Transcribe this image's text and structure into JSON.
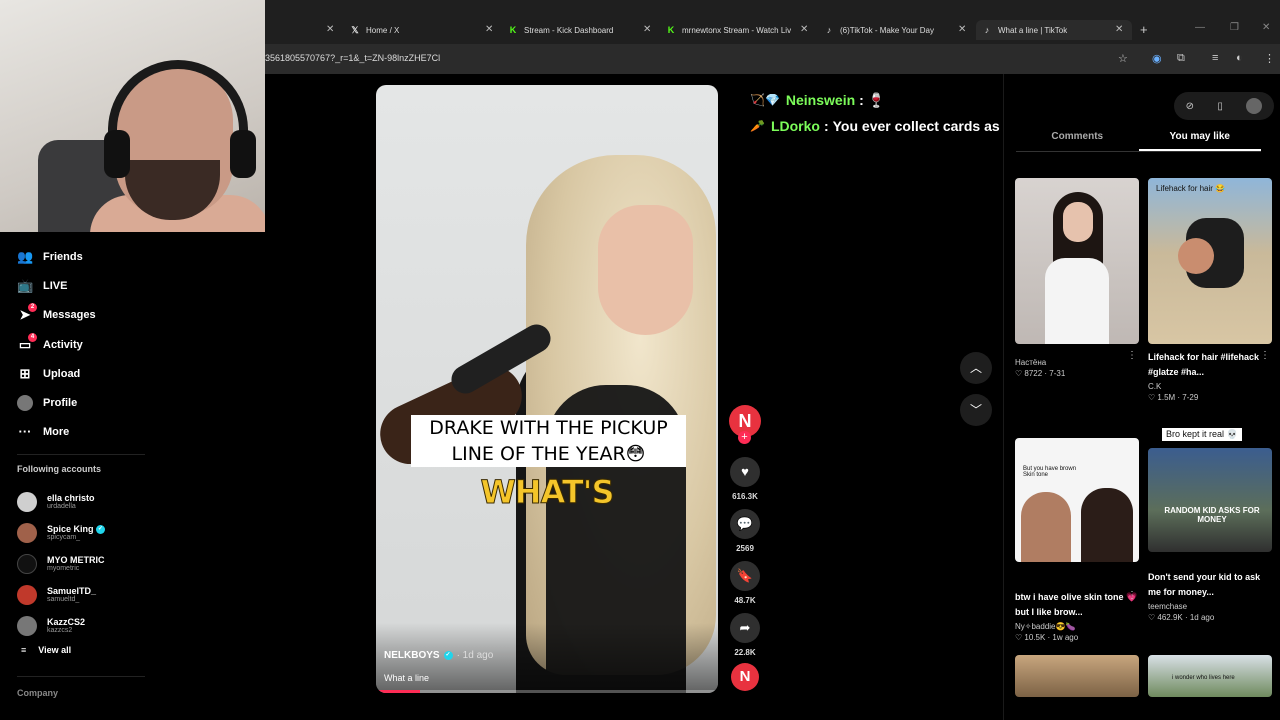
{
  "browser": {
    "tabs": [
      {
        "label": "Home / X",
        "icon": "x-logo"
      },
      {
        "label": "Stream - Kick Dashboard",
        "icon": "kick-logo"
      },
      {
        "label": "mrnewtonx Stream - Watch Liv",
        "icon": "kick-logo"
      },
      {
        "label": "(6)TikTok - Make Your Day",
        "icon": "tiktok-logo"
      },
      {
        "label": "What a line | TikTok",
        "icon": "tiktok-logo"
      }
    ],
    "url": "3561805570767?_r=1&_t=ZN-98lnzZHE7Cl"
  },
  "sidebar": {
    "items": [
      {
        "label": "Friends",
        "icon": "friends-icon"
      },
      {
        "label": "LIVE",
        "icon": "live-icon"
      },
      {
        "label": "Messages",
        "icon": "messages-icon",
        "badge": "2"
      },
      {
        "label": "Activity",
        "icon": "activity-icon",
        "badge": "4"
      },
      {
        "label": "Upload",
        "icon": "upload-icon"
      },
      {
        "label": "Profile",
        "icon": "avatar"
      },
      {
        "label": "More",
        "icon": "more-icon"
      }
    ],
    "following_title": "Following accounts",
    "accounts": [
      {
        "name": "ella christo",
        "handle": "urdadella",
        "color": "#cfcfcf"
      },
      {
        "name": "Spice King",
        "handle": "spicycam_",
        "color": "#a0614a",
        "verified": true
      },
      {
        "name": "MYO METRIC",
        "handle": "myometric",
        "color": "#111111"
      },
      {
        "name": "SamuelTD_",
        "handle": "samueltd_",
        "color": "#c0392b"
      },
      {
        "name": "KazzCS2",
        "handle": "kazzcs2",
        "color": "#777777"
      }
    ],
    "view_all": "View all",
    "company": "Company"
  },
  "video": {
    "caption": "DRAKE WITH THE PICKUP LINE OF THE YEAR😳",
    "overlay_word": "WHAT'S",
    "author": "NELKBOYS",
    "date": "· 1d ago",
    "description": "What a line",
    "progress": 0.13
  },
  "actions": {
    "creator_initial": "N",
    "likes": "616.3K",
    "comments": "2569",
    "saves": "48.7K",
    "shares": "22.8K"
  },
  "chat": [
    {
      "emotes": "🏹💎",
      "user": "Neinswein",
      "message": "🍷"
    },
    {
      "emotes": "🥕",
      "user": "LDorko",
      "message": "You ever collect cards as a kid?"
    }
  ],
  "right_panel": {
    "tabs": [
      "Comments",
      "You may like"
    ],
    "active_tab": "You may like",
    "cards": [
      {
        "title": "",
        "author": "Настёна",
        "stats": "♡ 8722 · 7-31",
        "thumb_tag": ""
      },
      {
        "title": "Lifehack for hair #lifehack #glatze #ha...",
        "author": "C.K",
        "stats": "♡ 1.5M · 7-29",
        "thumb_tag": "Lifehack for hair 😂"
      },
      {
        "title": "btw i have olive skin tone 💗 but I like brow...",
        "author": "Ny✧baddie😎🍆",
        "stats": "♡ 10.5K · 1w ago",
        "thumb_tag": "But you have brown Skin tone"
      },
      {
        "title": "Don't send your kid to ask me for money...",
        "author": "teemchase",
        "stats": "♡ 462.9K · 1d ago",
        "thumb_tag": "RANDOM KID ASKS FOR MONEY"
      }
    ],
    "card4_top_tag": "Bro kept it real 💀",
    "card6_tag": "i wonder who lives here"
  }
}
